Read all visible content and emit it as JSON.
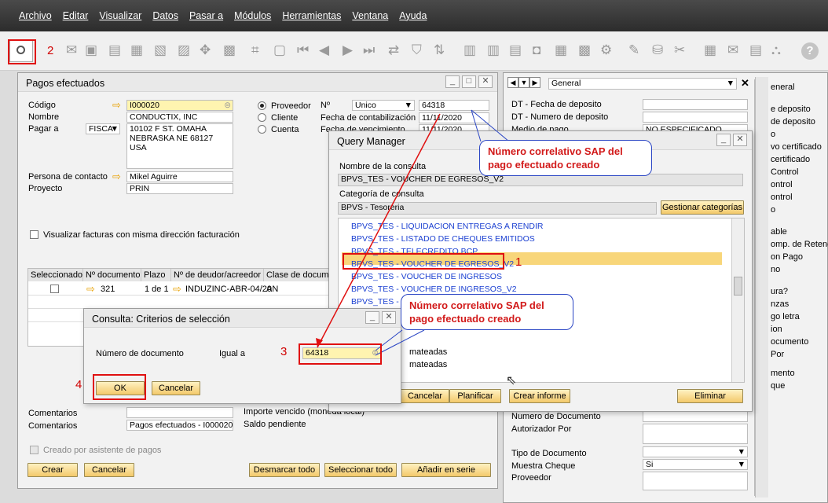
{
  "menu": [
    "Archivo",
    "Editar",
    "Visualizar",
    "Datos",
    "Pasar a",
    "Módulos",
    "Herramientas",
    "Ventana",
    "Ayuda"
  ],
  "toolbar": {
    "step_label": "2"
  },
  "pagos": {
    "title": "Pagos efectuados",
    "codigo_label": "Código",
    "codigo_value": "I000020",
    "nombre_label": "Nombre",
    "nombre_value": "CONDUCTIX, INC",
    "pagar_label": "Pagar a",
    "pagar_select": "FISCA",
    "address": [
      "10102 F ST. OMAHA",
      "NEBRASKA NE  68127",
      "USA"
    ],
    "contacto_label": "Persona de contacto",
    "contacto_value": "Mikel Aguirre",
    "proyecto_label": "Proyecto",
    "proyecto_value": "PRIN",
    "radios": [
      "Proveedor",
      "Cliente",
      "Cuenta"
    ],
    "no_label": "Nº",
    "serie": "Unico",
    "numero": "64318",
    "fecha_cont_label": "Fecha de contabilización",
    "fecha_cont": "11/11/2020",
    "fecha_venc_label": "Fecha de vencimiento",
    "fecha_venc": "11/11/2020",
    "visualizar_label": "Visualizar facturas con misma dirección facturación",
    "table_headers": [
      "Seleccionado",
      "Nº documento",
      "Plazo",
      "Nº de deudor/acreedor",
      "Clase de docume"
    ],
    "row": {
      "doc": "321",
      "plazo": "1 de 1",
      "deudor": "INDUZINC-ABR-04/20",
      "clase": "AN"
    },
    "comentarios_label": "Comentarios",
    "comentarios2_value": "Pagos efectuados - I000020",
    "importe_label": "Importe vencido (moneda local)",
    "saldo_label": "Saldo pendiente",
    "creado_label": "Creado por asistente de pagos",
    "btn_crear": "Crear",
    "btn_cancelar": "Cancelar",
    "btn_desmarcar": "Desmarcar todo",
    "btn_seleccionar": "Seleccionar todo",
    "btn_serie": "Añadir en serie"
  },
  "general": {
    "select": "General",
    "fields": [
      "DT - Fecha de deposito",
      "DT - Numero de deposito",
      "Medio de pago"
    ],
    "no_especificado": "NO ESPECIFICADO",
    "bottom_fields": [
      "Numero de Documento",
      "Autorizador Por",
      "Tipo de Documento",
      "Muestra Cheque",
      "Proveedor"
    ],
    "muestra_value": "Si",
    "right_labels": [
      "eneral",
      "e deposito",
      "de deposito",
      "o",
      "vo certificado",
      "certificado",
      "Control",
      "ontrol",
      "ontrol",
      "o",
      "able",
      "omp. de Retenci",
      "on Pago",
      "no",
      "ura?",
      "nzas",
      "go letra",
      "ion",
      "ocumento",
      "Por",
      "mento",
      "que"
    ]
  },
  "query": {
    "title": "Query Manager",
    "nombre_label": "Nombre de la consulta",
    "nombre_value": "BPVS_TES - VOUCHER DE EGRESOS_V2",
    "categoria_label": "Categoría de consulta",
    "categoria_value": "BPVS - Tesoreria",
    "gestionar": "Gestionar categorías",
    "items": [
      "BPVS_TES - LIQUIDACION ENTREGAS A RENDIR",
      "BPVS_TES - LISTADO DE CHEQUES EMITIDOS",
      "BPVS_TES - TELECREDITO BCP",
      "BPVS_TES - VOUCHER DE EGRESOS_V2",
      "BPVS_TES - VOUCHER DE INGRESOS",
      "BPVS_TES - VOUCHER DE INGRESOS_V2",
      "BPVS_TES - VO"
    ],
    "partial_items": [
      "mateadas",
      "mateadas"
    ],
    "btn_cancelar": "Cancelar",
    "btn_planificar": "Planificar",
    "btn_crear": "Crear informe",
    "btn_eliminar": "Eliminar"
  },
  "consulta": {
    "title": "Consulta: Criterios de selección",
    "campo_label": "Número de documento",
    "igual_label": "Igual a",
    "valor": "64318",
    "btn_ok": "OK",
    "btn_cancelar": "Cancelar"
  },
  "annotations": {
    "callout_text": "Número correlativo SAP del pago efectuado creado",
    "n1": "1",
    "n2": "2",
    "n3": "3",
    "n4": "4"
  }
}
